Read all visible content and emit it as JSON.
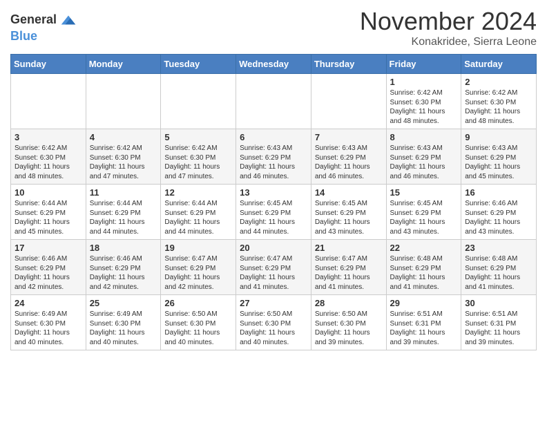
{
  "logo": {
    "line1": "General",
    "line2": "Blue"
  },
  "title": "November 2024",
  "location": "Konakridee, Sierra Leone",
  "header": {
    "days": [
      "Sunday",
      "Monday",
      "Tuesday",
      "Wednesday",
      "Thursday",
      "Friday",
      "Saturday"
    ]
  },
  "weeks": [
    [
      {
        "day": "",
        "info": ""
      },
      {
        "day": "",
        "info": ""
      },
      {
        "day": "",
        "info": ""
      },
      {
        "day": "",
        "info": ""
      },
      {
        "day": "",
        "info": ""
      },
      {
        "day": "1",
        "info": "Sunrise: 6:42 AM\nSunset: 6:30 PM\nDaylight: 11 hours\nand 48 minutes."
      },
      {
        "day": "2",
        "info": "Sunrise: 6:42 AM\nSunset: 6:30 PM\nDaylight: 11 hours\nand 48 minutes."
      }
    ],
    [
      {
        "day": "3",
        "info": "Sunrise: 6:42 AM\nSunset: 6:30 PM\nDaylight: 11 hours\nand 48 minutes."
      },
      {
        "day": "4",
        "info": "Sunrise: 6:42 AM\nSunset: 6:30 PM\nDaylight: 11 hours\nand 47 minutes."
      },
      {
        "day": "5",
        "info": "Sunrise: 6:42 AM\nSunset: 6:30 PM\nDaylight: 11 hours\nand 47 minutes."
      },
      {
        "day": "6",
        "info": "Sunrise: 6:43 AM\nSunset: 6:29 PM\nDaylight: 11 hours\nand 46 minutes."
      },
      {
        "day": "7",
        "info": "Sunrise: 6:43 AM\nSunset: 6:29 PM\nDaylight: 11 hours\nand 46 minutes."
      },
      {
        "day": "8",
        "info": "Sunrise: 6:43 AM\nSunset: 6:29 PM\nDaylight: 11 hours\nand 46 minutes."
      },
      {
        "day": "9",
        "info": "Sunrise: 6:43 AM\nSunset: 6:29 PM\nDaylight: 11 hours\nand 45 minutes."
      }
    ],
    [
      {
        "day": "10",
        "info": "Sunrise: 6:44 AM\nSunset: 6:29 PM\nDaylight: 11 hours\nand 45 minutes."
      },
      {
        "day": "11",
        "info": "Sunrise: 6:44 AM\nSunset: 6:29 PM\nDaylight: 11 hours\nand 44 minutes."
      },
      {
        "day": "12",
        "info": "Sunrise: 6:44 AM\nSunset: 6:29 PM\nDaylight: 11 hours\nand 44 minutes."
      },
      {
        "day": "13",
        "info": "Sunrise: 6:45 AM\nSunset: 6:29 PM\nDaylight: 11 hours\nand 44 minutes."
      },
      {
        "day": "14",
        "info": "Sunrise: 6:45 AM\nSunset: 6:29 PM\nDaylight: 11 hours\nand 43 minutes."
      },
      {
        "day": "15",
        "info": "Sunrise: 6:45 AM\nSunset: 6:29 PM\nDaylight: 11 hours\nand 43 minutes."
      },
      {
        "day": "16",
        "info": "Sunrise: 6:46 AM\nSunset: 6:29 PM\nDaylight: 11 hours\nand 43 minutes."
      }
    ],
    [
      {
        "day": "17",
        "info": "Sunrise: 6:46 AM\nSunset: 6:29 PM\nDaylight: 11 hours\nand 42 minutes."
      },
      {
        "day": "18",
        "info": "Sunrise: 6:46 AM\nSunset: 6:29 PM\nDaylight: 11 hours\nand 42 minutes."
      },
      {
        "day": "19",
        "info": "Sunrise: 6:47 AM\nSunset: 6:29 PM\nDaylight: 11 hours\nand 42 minutes."
      },
      {
        "day": "20",
        "info": "Sunrise: 6:47 AM\nSunset: 6:29 PM\nDaylight: 11 hours\nand 41 minutes."
      },
      {
        "day": "21",
        "info": "Sunrise: 6:47 AM\nSunset: 6:29 PM\nDaylight: 11 hours\nand 41 minutes."
      },
      {
        "day": "22",
        "info": "Sunrise: 6:48 AM\nSunset: 6:29 PM\nDaylight: 11 hours\nand 41 minutes."
      },
      {
        "day": "23",
        "info": "Sunrise: 6:48 AM\nSunset: 6:29 PM\nDaylight: 11 hours\nand 41 minutes."
      }
    ],
    [
      {
        "day": "24",
        "info": "Sunrise: 6:49 AM\nSunset: 6:30 PM\nDaylight: 11 hours\nand 40 minutes."
      },
      {
        "day": "25",
        "info": "Sunrise: 6:49 AM\nSunset: 6:30 PM\nDaylight: 11 hours\nand 40 minutes."
      },
      {
        "day": "26",
        "info": "Sunrise: 6:50 AM\nSunset: 6:30 PM\nDaylight: 11 hours\nand 40 minutes."
      },
      {
        "day": "27",
        "info": "Sunrise: 6:50 AM\nSunset: 6:30 PM\nDaylight: 11 hours\nand 40 minutes."
      },
      {
        "day": "28",
        "info": "Sunrise: 6:50 AM\nSunset: 6:30 PM\nDaylight: 11 hours\nand 39 minutes."
      },
      {
        "day": "29",
        "info": "Sunrise: 6:51 AM\nSunset: 6:31 PM\nDaylight: 11 hours\nand 39 minutes."
      },
      {
        "day": "30",
        "info": "Sunrise: 6:51 AM\nSunset: 6:31 PM\nDaylight: 11 hours\nand 39 minutes."
      }
    ]
  ]
}
